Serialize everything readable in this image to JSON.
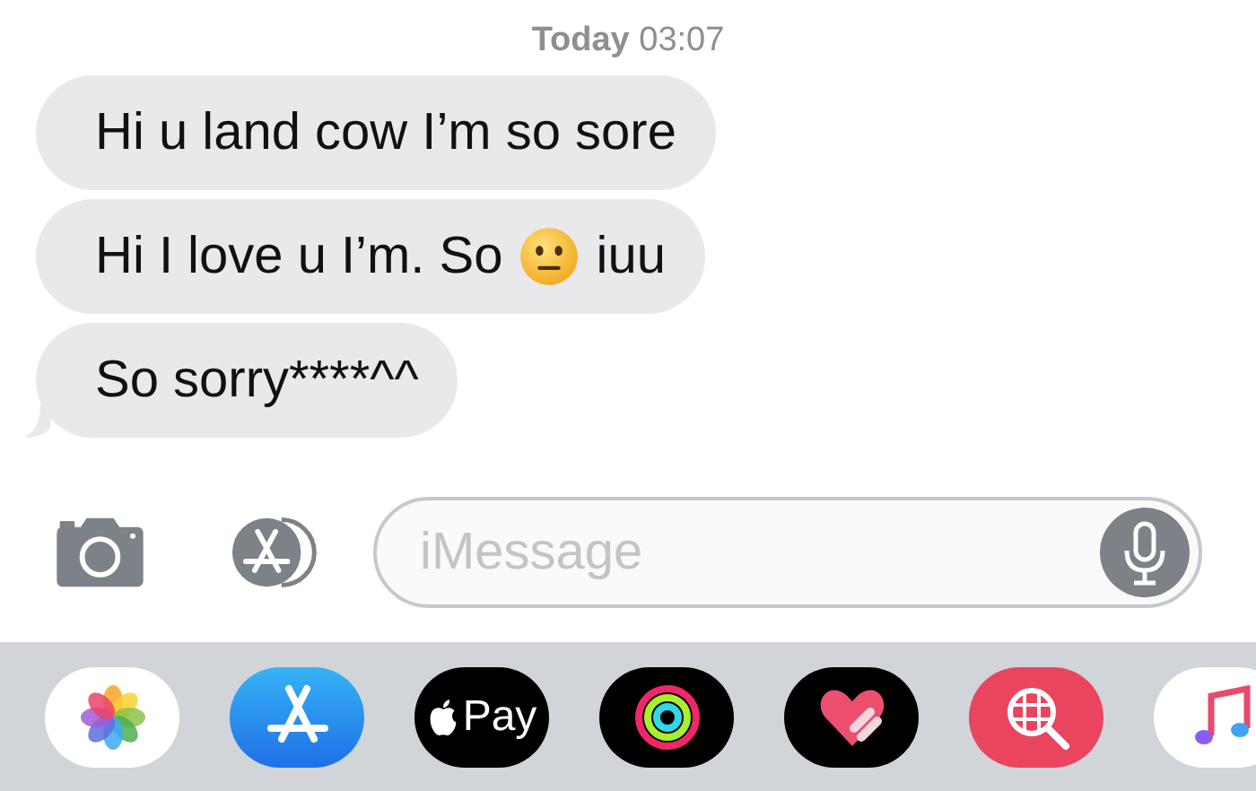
{
  "timestamp": {
    "day": "Today",
    "time": "03:07"
  },
  "messages": [
    {
      "kind": "text",
      "text": "Hi u land cow I’m so sore",
      "tail": false
    },
    {
      "kind": "emoji",
      "text": "Hi I love u I’m. So",
      "after": "iuu",
      "tail": false
    },
    {
      "kind": "text",
      "text": "So sorry****^^",
      "tail": true
    }
  ],
  "compose": {
    "placeholder": "iMessage"
  },
  "app_drawer": [
    {
      "kind": "photos"
    },
    {
      "kind": "appstore"
    },
    {
      "kind": "pay",
      "label": "Pay"
    },
    {
      "kind": "activity"
    },
    {
      "kind": "heart"
    },
    {
      "kind": "search"
    },
    {
      "kind": "music"
    }
  ]
}
